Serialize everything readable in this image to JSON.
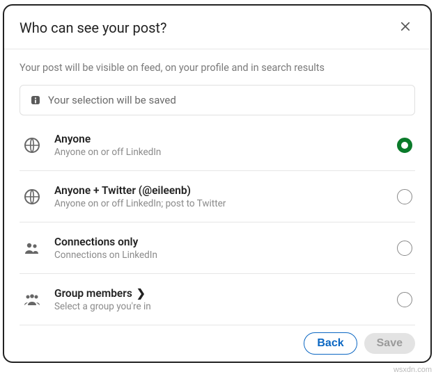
{
  "header": {
    "title": "Who can see your post?"
  },
  "subtitle": "Your post will be visible on feed, on your profile and in search results",
  "banner": {
    "text": "Your selection will be saved"
  },
  "options": [
    {
      "title": "Anyone",
      "desc": "Anyone on or off LinkedIn",
      "icon": "globe",
      "selected": true,
      "has_chevron": false
    },
    {
      "title": "Anyone + Twitter (@eileenb)",
      "desc": "Anyone on or off LinkedIn; post to Twitter",
      "icon": "globe",
      "selected": false,
      "has_chevron": false
    },
    {
      "title": "Connections only",
      "desc": "Connections on LinkedIn",
      "icon": "people-two",
      "selected": false,
      "has_chevron": false
    },
    {
      "title": "Group members",
      "desc": "Select a group you're in",
      "icon": "people-three",
      "selected": false,
      "has_chevron": true
    }
  ],
  "buttons": {
    "back": "Back",
    "save": "Save"
  },
  "watermark": "wsxdn.com"
}
